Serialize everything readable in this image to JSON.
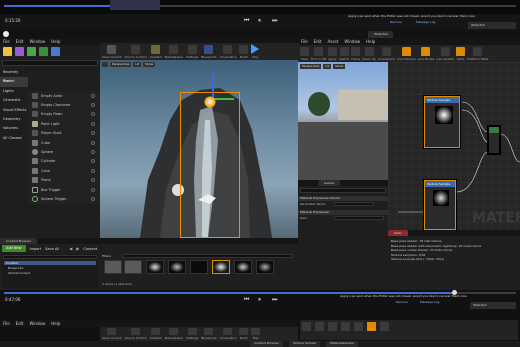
{
  "top_editor": {
    "timeline_label": "0:15:20",
    "notice": "Apply new spot when the Editor was not closed, would you like to recover them now",
    "notice_btn": "Recover",
    "notice_btn2": "Message Log"
  },
  "main_editor": {
    "tab_title": "",
    "menu": [
      "File",
      "Edit",
      "Window",
      "Help"
    ],
    "toolbar": [
      "Save Current",
      "Source Control",
      "Content",
      "Marketplace",
      "Settings",
      "Blueprints",
      "Cinematics",
      "Build",
      "Play"
    ],
    "modes": {
      "header": "Recently Placed",
      "categories": [
        "Basic",
        "Lights",
        "Cinematic",
        "Visual Effects",
        "Geometry",
        "Volumes",
        "All Classes"
      ],
      "items": [
        "Empty Actor",
        "Empty Character",
        "Empty Pawn",
        "Point Light",
        "Player Start",
        "Cube",
        "Sphere",
        "Cylinder",
        "Cone",
        "Plane",
        "Box Trigger",
        "Sphere Trigger"
      ]
    },
    "viewport": {
      "perspective": "Perspective",
      "lit": "Lit",
      "show": "Show"
    },
    "content_browser": {
      "tab": "Content Browser",
      "add_new": "Add New",
      "import": "Import",
      "save_all": "Save All",
      "path": "Content",
      "filters": "Filters",
      "tree": [
        "Content",
        "Blueprints",
        "StarterContent"
      ],
      "status": "9 items (1 selected)"
    }
  },
  "material_editor": {
    "menu": [
      "File",
      "Edit",
      "Asset",
      "Window",
      "Help"
    ],
    "toolbar": [
      "Save",
      "Find in CB",
      "Apply",
      "Search",
      "Home",
      "Clean Up",
      "Connectors",
      "Live Preview",
      "Live Nodes",
      "Live Update",
      "Stats",
      "Platform Stats"
    ],
    "preview": {
      "perspective": "Perspective",
      "lit": "Lit",
      "show": "Show"
    },
    "details_tab": "Details",
    "sections": [
      {
        "title": "Material Expression Param",
        "fields": [
          {
            "label": "Parameter Name",
            "value": ""
          }
        ]
      },
      {
        "title": "Material Expression",
        "fields": [
          {
            "label": "Desc",
            "value": ""
          }
        ]
      }
    ],
    "nodes": [
      {
        "title": "Texture Sample",
        "pins": [
          "UVs",
          "Tex",
          "RGB",
          "R",
          "G",
          "B",
          "A"
        ]
      },
      {
        "title": "Texture Sample",
        "pins": [
          "UVs",
          "Tex",
          "RGB",
          "R",
          "G",
          "B",
          "A"
        ]
      }
    ],
    "stats": {
      "tab": "Stats",
      "lines": [
        "Base pass shader: 78 instructions",
        "Base pass shader with Volumetric Lightmap: 92 instructions",
        "Base pass vertex shader: 33 instructions",
        "Texture samplers: 3/16",
        "Texture Lookups (Est.): VS(0), PS(1)"
      ]
    },
    "watermark": "MATER"
  },
  "bottom_editor": {
    "timeline_label": "0:47:06",
    "notice": "Apply new spot when the Editor was not closed, would you like to recover them now",
    "notice_btn": "Recover",
    "notice_btn2": "Message Log",
    "menu": [
      "File",
      "Edit",
      "Window",
      "Help"
    ],
    "tabs": [
      "Content Browser",
      "Texture Sample",
      "MaterialSample"
    ],
    "toolbar": [
      "Save Current",
      "Source Control",
      "Content",
      "Marketplace",
      "Settings",
      "Blueprints",
      "Cinematics",
      "Build",
      "Play"
    ],
    "status": "Waterfall"
  },
  "colors": {
    "accent": "#e08a00",
    "node_header": "#3b6aa8",
    "selection": "#f08c00",
    "panel": "#262626"
  }
}
